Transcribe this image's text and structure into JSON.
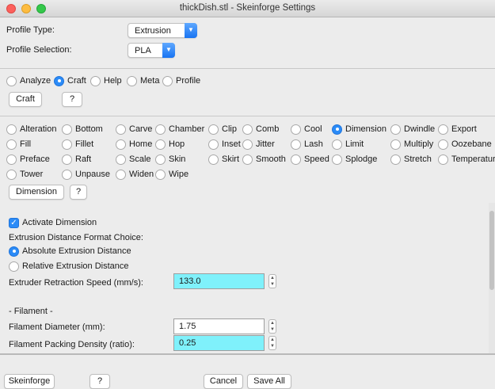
{
  "window": {
    "title": "thickDish.stl - Skeinforge Settings"
  },
  "profile": {
    "type_label": "Profile Type:",
    "type_value": "Extrusion",
    "selection_label": "Profile Selection:",
    "selection_value": "PLA"
  },
  "modes": [
    {
      "label": "Analyze",
      "selected": false
    },
    {
      "label": "Craft",
      "selected": true
    },
    {
      "label": "Help",
      "selected": false
    },
    {
      "label": "Meta",
      "selected": false
    },
    {
      "label": "Profile",
      "selected": false
    }
  ],
  "mode_buttons": {
    "craft": "Craft",
    "help": "?"
  },
  "plugins": {
    "selected": "Dimension",
    "rows": [
      [
        "Alteration",
        "Bottom",
        "Carve",
        "Chamber",
        "Clip",
        "Comb",
        "Cool",
        "Dimension",
        "Dwindle",
        "Export"
      ],
      [
        "Fill",
        "Fillet",
        "Home",
        "Hop",
        "Inset",
        "Jitter",
        "Lash",
        "Limit",
        "Multiply",
        "Oozebane"
      ],
      [
        "Preface",
        "Raft",
        "Scale",
        "Skin",
        "Skirt",
        "Smooth",
        "Speed",
        "Splodge",
        "Stretch",
        "Temperature"
      ],
      [
        "Tower",
        "Unpause",
        "Widen",
        "Wipe"
      ]
    ]
  },
  "plugin_buttons": {
    "dimension": "Dimension",
    "help": "?"
  },
  "settings": {
    "activate_label": "Activate Dimension",
    "activate_checked": true,
    "format_choice_label": "Extrusion Distance Format Choice:",
    "absolute_label": "Absolute Extrusion Distance",
    "relative_label": "Relative Extrusion Distance",
    "format_selected": "absolute",
    "retraction_speed_label": "Extruder Retraction Speed (mm/s):",
    "retraction_speed_value": "133.0",
    "filament_heading": "- Filament -",
    "filament_diameter_label": "Filament Diameter (mm):",
    "filament_diameter_value": "1.75",
    "packing_density_label": "Filament Packing Density (ratio):",
    "packing_density_value": "0.25"
  },
  "footer": {
    "skeinforge": "Skeinforge",
    "help": "?",
    "cancel": "Cancel",
    "save_all": "Save All"
  },
  "colors": {
    "accent": "#2b8bf7",
    "field_highlight": "#7ff1fb"
  }
}
